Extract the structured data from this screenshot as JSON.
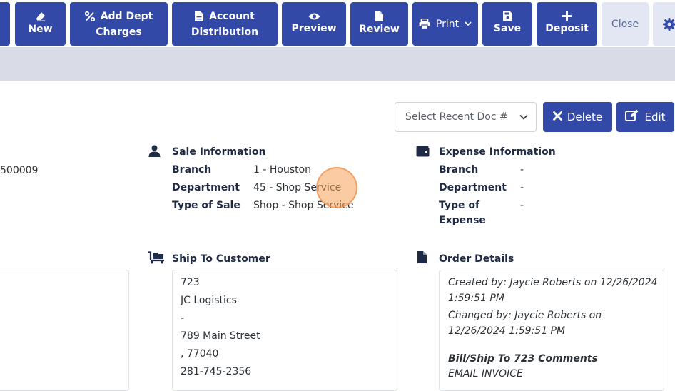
{
  "toolbar": {
    "new": "New",
    "add_dept_charges_1": "Add Dept",
    "add_dept_charges_2": "Charges",
    "account_distribution_1": "Account",
    "account_distribution_2": "Distribution",
    "preview": "Preview",
    "review": "Review",
    "print": "Print",
    "save": "Save",
    "deposit": "Deposit",
    "close": "Close"
  },
  "actions": {
    "recent_doc_placeholder": "Select Recent Doc #",
    "delete": "Delete",
    "edit": "Edit"
  },
  "left": {
    "doc_number_partial": "500009"
  },
  "sale_info": {
    "title": "Sale Information",
    "branch_label": "Branch",
    "branch_value": "1 - Houston",
    "department_label": "Department",
    "department_value": "45 - Shop Service",
    "type_label": "Type of Sale",
    "type_value": "Shop - Shop Service"
  },
  "expense_info": {
    "title": "Expense Information",
    "branch_label": "Branch",
    "branch_value": "-",
    "department_label": "Department",
    "department_value": "-",
    "type_label_1": "Type of",
    "type_label_2": "Expense",
    "type_value": "-"
  },
  "ship_to": {
    "title": "Ship To Customer",
    "lines": [
      "723",
      "JC Logistics",
      "-",
      "789 Main Street",
      ", 77040",
      "281-745-2356"
    ]
  },
  "order_details": {
    "title": "Order Details",
    "created_1": "Created by: Jaycie Roberts on 12/26/2024",
    "created_2": "1:59:51 PM",
    "changed_1": "Changed by: Jaycie Roberts on",
    "changed_2": "12/26/2024 1:59:51 PM",
    "comments_title": "Bill/Ship To 723 Comments",
    "comments_text": "EMAIL INVOICE"
  },
  "icons": {
    "eraser": "eraser-icon",
    "percent": "percent-icon",
    "file": "file-icon",
    "eye": "eye-icon",
    "print": "printer-icon",
    "save": "floppy-icon",
    "plus": "plus-icon",
    "gear": "gear-icon",
    "user": "user-icon",
    "wallet": "wallet-icon",
    "dolly": "dolly-icon"
  },
  "colors": {
    "primary": "#3349a8",
    "subbar": "#d9dbe6",
    "close_bg": "#e3e6f3"
  }
}
